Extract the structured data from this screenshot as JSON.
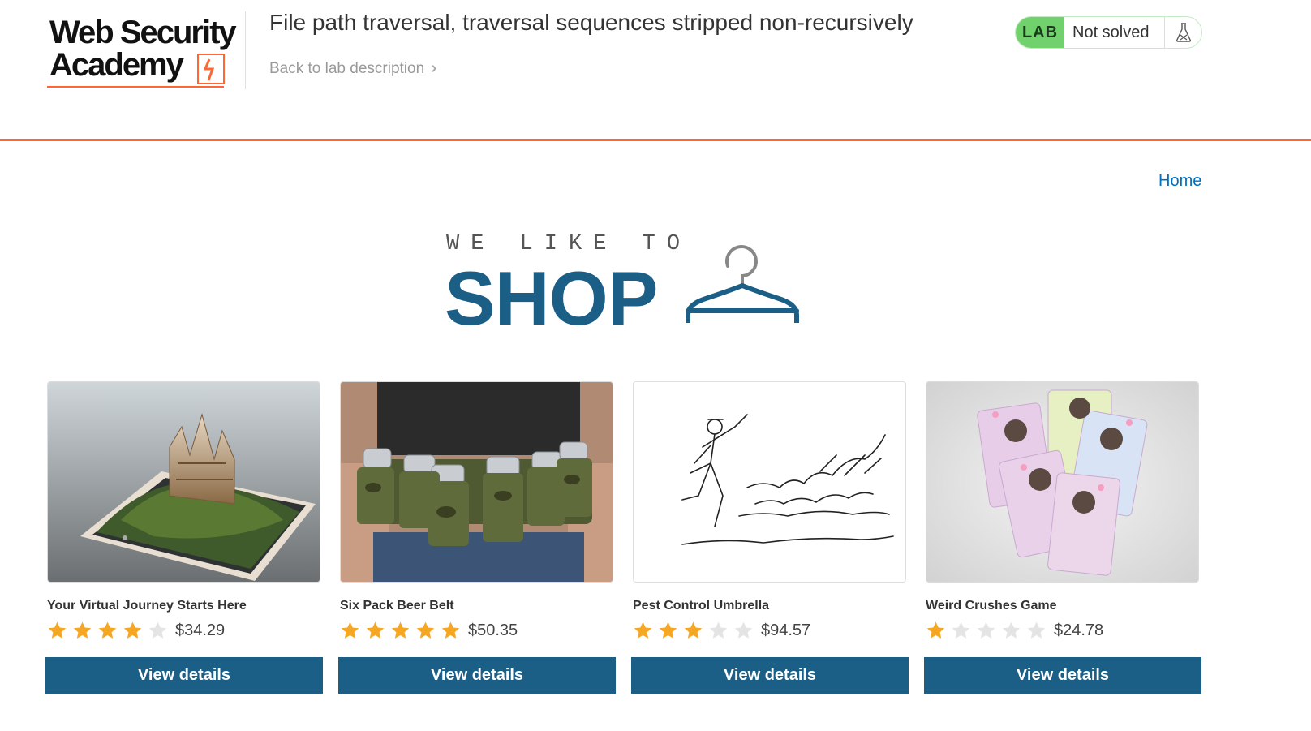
{
  "header": {
    "logo_line1": "Web Security",
    "logo_line2": "Academy",
    "lab_title": "File path traversal, traversal sequences stripped non-recursively",
    "back_link": "Back to lab description",
    "lab_badge": "LAB",
    "lab_status": "Not solved",
    "accent_color": "#ff6633",
    "status_color": "#70d16d"
  },
  "nav": {
    "home": "Home"
  },
  "banner": {
    "tagline": "WE LIKE TO",
    "title": "SHOP",
    "color": "#1c5f86"
  },
  "products": [
    {
      "name": "Your Virtual Journey Starts Here",
      "rating": 4,
      "price": "$34.29",
      "button": "View details",
      "image": "phone-castle-image"
    },
    {
      "name": "Six Pack Beer Belt",
      "rating": 5,
      "price": "$50.35",
      "button": "View details",
      "image": "beer-belt-image"
    },
    {
      "name": "Pest Control Umbrella",
      "rating": 3,
      "price": "$94.57",
      "button": "View details",
      "image": "umbrella-sketch-image"
    },
    {
      "name": "Weird Crushes Game",
      "rating": 1,
      "price": "$24.78",
      "button": "View details",
      "image": "crushes-cards-image"
    }
  ]
}
